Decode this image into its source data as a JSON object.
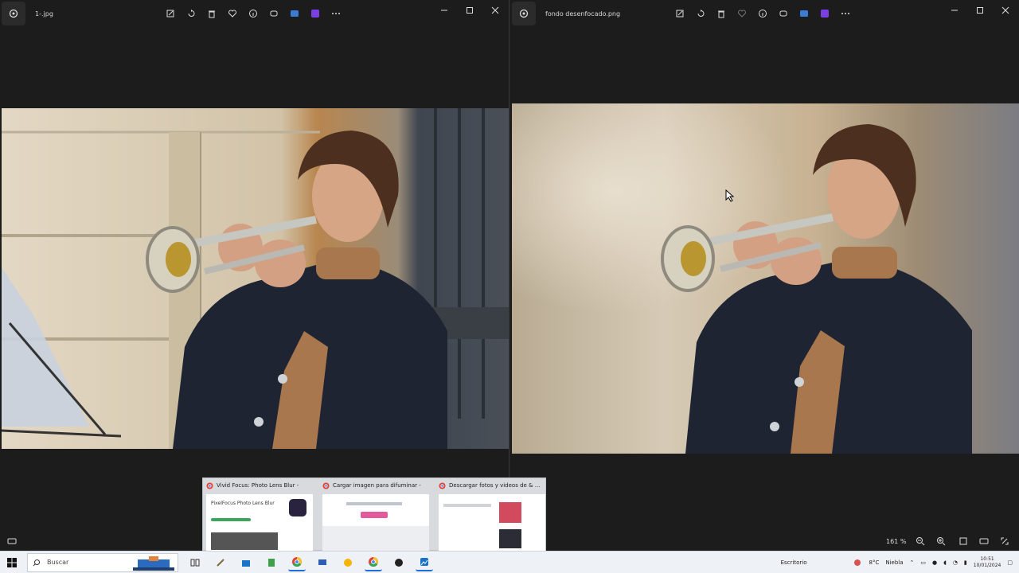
{
  "left_window": {
    "title": "1-.jpg",
    "zoom": ""
  },
  "right_window": {
    "title": "fondo desenfocado.png",
    "zoom": "161 %"
  },
  "taskbar": {
    "search_placeholder": "Buscar",
    "weather_temp": "8°C",
    "weather_desc": "Niebla",
    "time": "10:51",
    "date": "10/01/2024",
    "status_text": "Escritorio"
  },
  "preview": {
    "cards": [
      {
        "title": "Vivid Focus: Photo Lens Blur -"
      },
      {
        "title": "Cargar imagen para difuminar -"
      },
      {
        "title": "Descargar fotos y videos de & #F..."
      }
    ],
    "thumb_app_name": "PixelFocus Photo Lens Blur"
  },
  "colors": {
    "viewer_bg": "#1c1c1c",
    "taskbar_bg": "#eef1f5",
    "accent": "#1e6fd9"
  }
}
